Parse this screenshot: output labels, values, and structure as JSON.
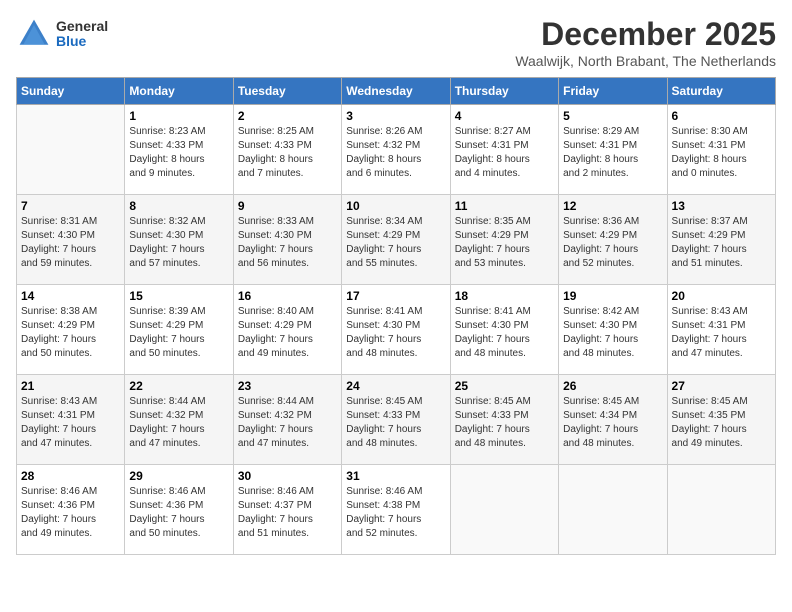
{
  "header": {
    "logo_general": "General",
    "logo_blue": "Blue",
    "title": "December 2025",
    "location": "Waalwijk, North Brabant, The Netherlands"
  },
  "days_of_week": [
    "Sunday",
    "Monday",
    "Tuesday",
    "Wednesday",
    "Thursday",
    "Friday",
    "Saturday"
  ],
  "weeks": [
    [
      {
        "num": "",
        "info": ""
      },
      {
        "num": "1",
        "info": "Sunrise: 8:23 AM\nSunset: 4:33 PM\nDaylight: 8 hours\nand 9 minutes."
      },
      {
        "num": "2",
        "info": "Sunrise: 8:25 AM\nSunset: 4:33 PM\nDaylight: 8 hours\nand 7 minutes."
      },
      {
        "num": "3",
        "info": "Sunrise: 8:26 AM\nSunset: 4:32 PM\nDaylight: 8 hours\nand 6 minutes."
      },
      {
        "num": "4",
        "info": "Sunrise: 8:27 AM\nSunset: 4:31 PM\nDaylight: 8 hours\nand 4 minutes."
      },
      {
        "num": "5",
        "info": "Sunrise: 8:29 AM\nSunset: 4:31 PM\nDaylight: 8 hours\nand 2 minutes."
      },
      {
        "num": "6",
        "info": "Sunrise: 8:30 AM\nSunset: 4:31 PM\nDaylight: 8 hours\nand 0 minutes."
      }
    ],
    [
      {
        "num": "7",
        "info": "Sunrise: 8:31 AM\nSunset: 4:30 PM\nDaylight: 7 hours\nand 59 minutes."
      },
      {
        "num": "8",
        "info": "Sunrise: 8:32 AM\nSunset: 4:30 PM\nDaylight: 7 hours\nand 57 minutes."
      },
      {
        "num": "9",
        "info": "Sunrise: 8:33 AM\nSunset: 4:30 PM\nDaylight: 7 hours\nand 56 minutes."
      },
      {
        "num": "10",
        "info": "Sunrise: 8:34 AM\nSunset: 4:29 PM\nDaylight: 7 hours\nand 55 minutes."
      },
      {
        "num": "11",
        "info": "Sunrise: 8:35 AM\nSunset: 4:29 PM\nDaylight: 7 hours\nand 53 minutes."
      },
      {
        "num": "12",
        "info": "Sunrise: 8:36 AM\nSunset: 4:29 PM\nDaylight: 7 hours\nand 52 minutes."
      },
      {
        "num": "13",
        "info": "Sunrise: 8:37 AM\nSunset: 4:29 PM\nDaylight: 7 hours\nand 51 minutes."
      }
    ],
    [
      {
        "num": "14",
        "info": "Sunrise: 8:38 AM\nSunset: 4:29 PM\nDaylight: 7 hours\nand 50 minutes."
      },
      {
        "num": "15",
        "info": "Sunrise: 8:39 AM\nSunset: 4:29 PM\nDaylight: 7 hours\nand 50 minutes."
      },
      {
        "num": "16",
        "info": "Sunrise: 8:40 AM\nSunset: 4:29 PM\nDaylight: 7 hours\nand 49 minutes."
      },
      {
        "num": "17",
        "info": "Sunrise: 8:41 AM\nSunset: 4:30 PM\nDaylight: 7 hours\nand 48 minutes."
      },
      {
        "num": "18",
        "info": "Sunrise: 8:41 AM\nSunset: 4:30 PM\nDaylight: 7 hours\nand 48 minutes."
      },
      {
        "num": "19",
        "info": "Sunrise: 8:42 AM\nSunset: 4:30 PM\nDaylight: 7 hours\nand 48 minutes."
      },
      {
        "num": "20",
        "info": "Sunrise: 8:43 AM\nSunset: 4:31 PM\nDaylight: 7 hours\nand 47 minutes."
      }
    ],
    [
      {
        "num": "21",
        "info": "Sunrise: 8:43 AM\nSunset: 4:31 PM\nDaylight: 7 hours\nand 47 minutes."
      },
      {
        "num": "22",
        "info": "Sunrise: 8:44 AM\nSunset: 4:32 PM\nDaylight: 7 hours\nand 47 minutes."
      },
      {
        "num": "23",
        "info": "Sunrise: 8:44 AM\nSunset: 4:32 PM\nDaylight: 7 hours\nand 47 minutes."
      },
      {
        "num": "24",
        "info": "Sunrise: 8:45 AM\nSunset: 4:33 PM\nDaylight: 7 hours\nand 48 minutes."
      },
      {
        "num": "25",
        "info": "Sunrise: 8:45 AM\nSunset: 4:33 PM\nDaylight: 7 hours\nand 48 minutes."
      },
      {
        "num": "26",
        "info": "Sunrise: 8:45 AM\nSunset: 4:34 PM\nDaylight: 7 hours\nand 48 minutes."
      },
      {
        "num": "27",
        "info": "Sunrise: 8:45 AM\nSunset: 4:35 PM\nDaylight: 7 hours\nand 49 minutes."
      }
    ],
    [
      {
        "num": "28",
        "info": "Sunrise: 8:46 AM\nSunset: 4:36 PM\nDaylight: 7 hours\nand 49 minutes."
      },
      {
        "num": "29",
        "info": "Sunrise: 8:46 AM\nSunset: 4:36 PM\nDaylight: 7 hours\nand 50 minutes."
      },
      {
        "num": "30",
        "info": "Sunrise: 8:46 AM\nSunset: 4:37 PM\nDaylight: 7 hours\nand 51 minutes."
      },
      {
        "num": "31",
        "info": "Sunrise: 8:46 AM\nSunset: 4:38 PM\nDaylight: 7 hours\nand 52 minutes."
      },
      {
        "num": "",
        "info": ""
      },
      {
        "num": "",
        "info": ""
      },
      {
        "num": "",
        "info": ""
      }
    ]
  ]
}
